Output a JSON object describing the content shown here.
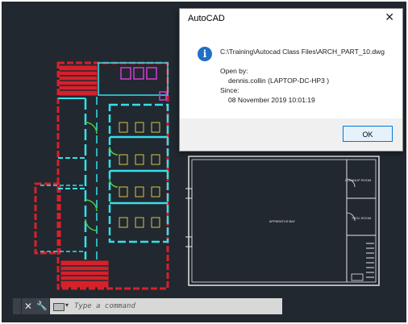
{
  "dialog": {
    "title": "AutoCAD",
    "close_glyph": "✕",
    "icon": "information-icon",
    "icon_glyph": "i",
    "file_path": "C:\\Training\\Autocad Class Files\\ARCH_PART_10.dwg",
    "open_by_label": "Open by:",
    "open_by_value": "dennis.collin (LAPTOP-DC-HP3 )",
    "since_label": "Since:",
    "since_value": "08 November 2019  10:01:19",
    "ok_label": "OK"
  },
  "drawing": {
    "room_labels": [
      "CLEANUP ROOM",
      "TOOL ROOM",
      "APPARATUS BAY"
    ]
  },
  "command_line": {
    "close_glyph": "✕",
    "wrench_glyph": "🔧",
    "caret_glyph": "▾",
    "placeholder": "Type a command"
  },
  "colors": {
    "canvas": "#212830",
    "wall_red": "#d8202a",
    "wall_cyan": "#35e0e8",
    "wall_white": "#e6e6e6",
    "fixture_yellow": "#d6c34a",
    "fixture_magenta": "#d43bd4",
    "door_green": "#4ecb3c",
    "accent_blue": "#0078d7"
  }
}
